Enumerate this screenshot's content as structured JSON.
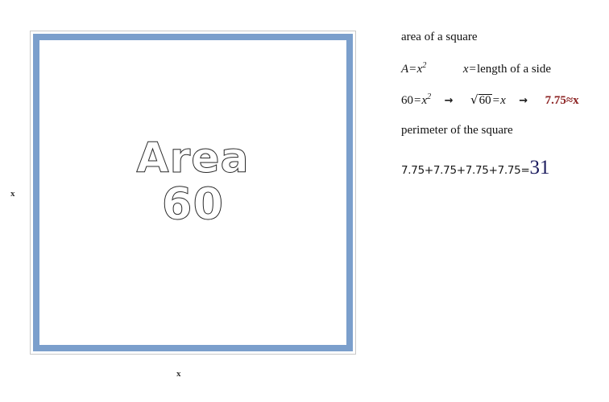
{
  "figure": {
    "shape_name": "square",
    "wordart": {
      "line1": "Area",
      "line2": "60"
    },
    "side_label_left": "x",
    "side_label_bottom": "x",
    "border_color": "#7b9fcc",
    "outline_color": "#c8c8c8"
  },
  "solution": {
    "area_heading": "area of a square",
    "formula": {
      "lhs": "A",
      "equals": "=",
      "base": "x",
      "exponent": "2",
      "definition_var": "x",
      "definition_equals": "=",
      "definition_text": "length of a side"
    },
    "substitution": {
      "value": "60",
      "equals": "=",
      "base": "x",
      "exponent": "2",
      "arrow1": "→",
      "radical_sign": "√",
      "radicand": "60",
      "radical_equals": "=",
      "radical_result": "x",
      "arrow2": "→",
      "approx_answer": "7.75≈x",
      "approx_color": "#8b2121"
    },
    "perimeter_heading": "perimeter of the square",
    "perimeter": {
      "sum_expression": "7.75+7.75+7.75+7.75=",
      "result": "31",
      "result_color": "#1b1b5e"
    }
  }
}
